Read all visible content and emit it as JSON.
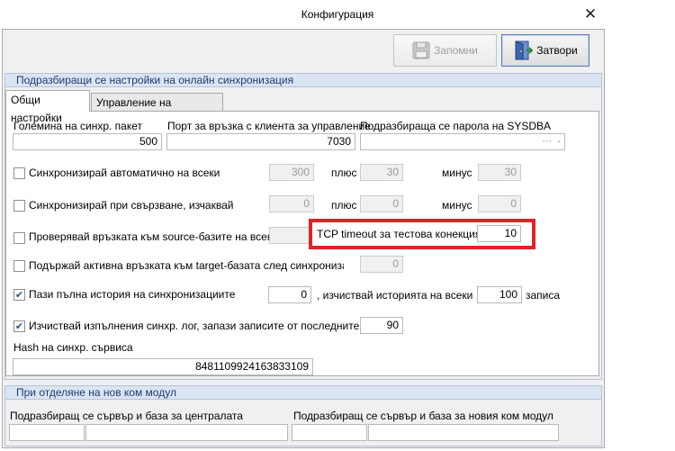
{
  "window": {
    "title": "Конфигурация",
    "close_glyph": "✕"
  },
  "toolbar": {
    "save_label": "Запомни",
    "close_label": "Затвори",
    "save_icon": "floppy-disk-icon",
    "close_icon": "door-exit-icon"
  },
  "defaults_group": {
    "title": "Подразбиращи се настройки на онлайн синхронизация"
  },
  "tabs": [
    {
      "label": "Общи настройки",
      "active": true
    },
    {
      "label": "Управление на конекциите",
      "active": false
    }
  ],
  "general": {
    "packet_size_label": "Големина на синхр. пакет",
    "packet_size_value": "500",
    "port_label": "Порт за връзка с клиента за управление",
    "port_value": "7030",
    "sysdba_label": "Подразбираща се парола на SYSDBA",
    "sysdba_value": "···",
    "sysdba_button": "-",
    "auto_sync": {
      "label": "Синхронизирай автоматично на всеки",
      "checked": false,
      "value": "300",
      "plus_label": "плюс",
      "plus_value": "30",
      "minus_label": "минус",
      "minus_value": "30"
    },
    "connect_sync": {
      "label": "Синхронизирай при свързване, изчаквай",
      "checked": false,
      "value": "0",
      "plus_label": "плюс",
      "plus_value": "0",
      "minus_label": "минус",
      "minus_value": "0"
    },
    "check_source": {
      "label": "Проверявай връзката към source-базите на всеки",
      "checked": false,
      "value": ""
    },
    "tcp_timeout": {
      "label": "TCP timeout за тестова конекция:",
      "value": "10"
    },
    "keep_target": {
      "label": "Подържай активна връзката към target-базата след синхронизация",
      "checked": false,
      "value": "0"
    },
    "full_history": {
      "label": "Пази пълна история на синхронизациите",
      "checked": true,
      "value": "0",
      "clear_label": ", изчиствай историята на всеки",
      "clear_value": "100",
      "records_label": "записа"
    },
    "clear_log": {
      "label": "Изчиствай изпълнения синхр. лог, запази записите от последните",
      "checked": true,
      "value": "90"
    },
    "hash_label": "Hash на синхр. сървиса",
    "hash_value": "8481109924163833109"
  },
  "new_module_group": {
    "title": "При отделяне на нов ком модул",
    "central_label": "Подразбиращ се сървър и база за централата",
    "new_module_label": "Подразбиращ се сървър и база за новия ком модул"
  }
}
